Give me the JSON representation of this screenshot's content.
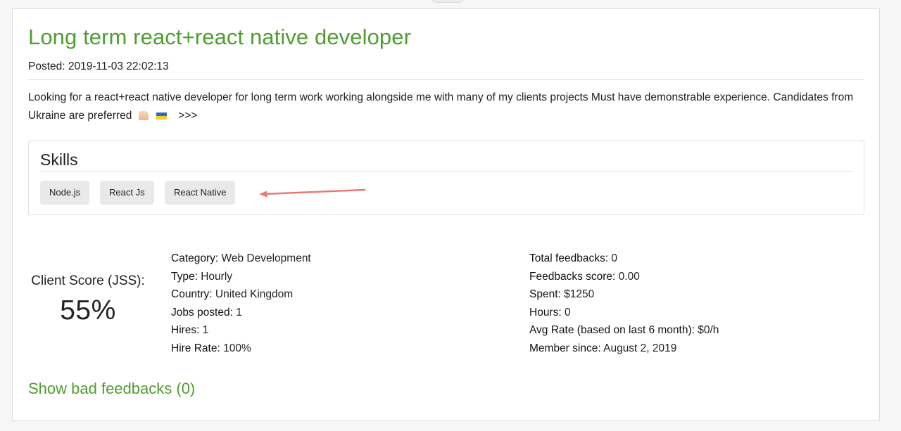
{
  "job": {
    "title": "Long term react+react native developer",
    "posted": "Posted: 2019-11-03 22:02:13",
    "description": "Looking for a react+react native developer for long term work working alongside me with many of my clients projects Must have demonstrable experience. Candidates from Ukraine are preferred",
    "more": ">>>"
  },
  "skills": {
    "heading": "Skills",
    "items": [
      "Node.js",
      "React Js",
      "React Native"
    ],
    "arrow_color": "#e87a74"
  },
  "client_score": {
    "label": "Client Score (JSS):",
    "value": "55%"
  },
  "details_left": [
    {
      "key": "Category:",
      "value": "Web Development"
    },
    {
      "key": "Type:",
      "value": "Hourly"
    },
    {
      "key": "Country:",
      "value": "United Kingdom"
    },
    {
      "key": "Jobs posted:",
      "value": "1"
    },
    {
      "key": "Hires:",
      "value": "1"
    },
    {
      "key": "Hire Rate:",
      "value": "100%"
    }
  ],
  "details_right": [
    {
      "key": "Total feedbacks:",
      "value": "0"
    },
    {
      "key": "Feedbacks score:",
      "value": "0.00"
    },
    {
      "key": "Spent:",
      "value": "$1250"
    },
    {
      "key": "Hours:",
      "value": "0"
    },
    {
      "key": "Avg Rate (based on last 6 month):",
      "value": "$0/h"
    },
    {
      "key": "Member since:",
      "value": "August 2, 2019"
    }
  ],
  "show_bad_feedbacks": "Show bad feedbacks (0)",
  "colors": {
    "accent": "#4f9d2f",
    "chip_bg": "#e9e9e9"
  }
}
